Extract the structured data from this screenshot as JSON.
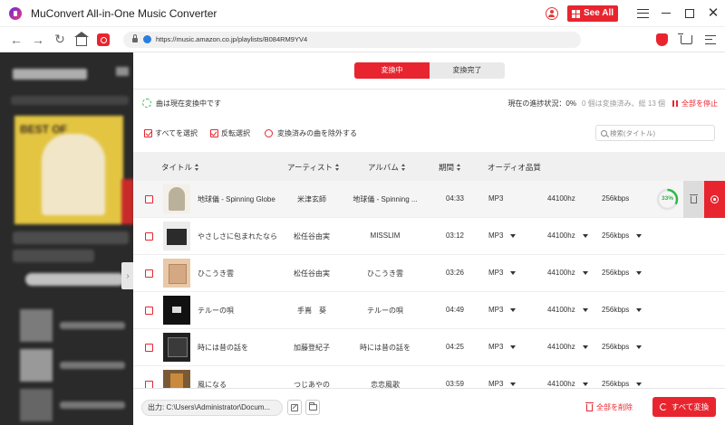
{
  "window": {
    "title": "MuConvert All-in-One Music Converter",
    "see_all_label": "See All"
  },
  "browser": {
    "url": "https://music.amazon.co.jp/playlists/B084RM9YV4"
  },
  "converter": {
    "tabs": [
      {
        "label": "変換中",
        "active": true
      },
      {
        "label": "変換完了",
        "active": false
      }
    ],
    "status_text": "曲は現在変換中です",
    "progress_text": "現在の進捗状況：0%",
    "count_text": "0 個は変換済み、総 13 個",
    "stop_all_label": "全部を停止",
    "select_all_label": "すべてを選択",
    "invert_select_label": "反転選択",
    "exclude_converted_label": "変換済みの曲を除外する",
    "search_placeholder": "検索(タイトル)",
    "columns": {
      "title": "タイトル",
      "artist": "アーティスト",
      "album": "アルバム",
      "duration": "期間",
      "audio_quality": "オーディオ品質"
    },
    "rows": [
      {
        "title": "地球儀 - Spinning Globe",
        "artist": "米津玄師",
        "album": "地球儀 - Spinning ...",
        "duration": "04:33",
        "format": "MP3",
        "sample_rate": "44100hz",
        "bitrate": "256kbps",
        "progress": "33%"
      },
      {
        "title": "やさしさに包まれたなら",
        "artist": "松任谷由実",
        "album": "MISSLIM",
        "duration": "03:12",
        "format": "MP3",
        "sample_rate": "44100hz",
        "bitrate": "256kbps"
      },
      {
        "title": "ひこうき雲",
        "artist": "松任谷由実",
        "album": "ひこうき雲",
        "duration": "03:26",
        "format": "MP3",
        "sample_rate": "44100hz",
        "bitrate": "256kbps"
      },
      {
        "title": "テルーの唄",
        "artist": "手嶌　葵",
        "album": "テルーの唄",
        "duration": "04:49",
        "format": "MP3",
        "sample_rate": "44100hz",
        "bitrate": "256kbps"
      },
      {
        "title": "時には昔の話を",
        "artist": "加藤登紀子",
        "album": "時には昔の話を",
        "duration": "04:25",
        "format": "MP3",
        "sample_rate": "44100hz",
        "bitrate": "256kbps"
      },
      {
        "title": "風になる",
        "artist": "つじあやの",
        "album": "恋恋風歌",
        "duration": "03:59",
        "format": "MP3",
        "sample_rate": "44100hz",
        "bitrate": "256kbps"
      }
    ],
    "output_path": "出力: C:\\Users\\Administrator\\Docum...",
    "delete_all_label": "全部を削除",
    "convert_all_label": "すべて変換"
  },
  "sidebar": {
    "album_label": "BEST OF"
  },
  "colors": {
    "accent": "#e8252f",
    "progress_green": "#2ab94a"
  }
}
